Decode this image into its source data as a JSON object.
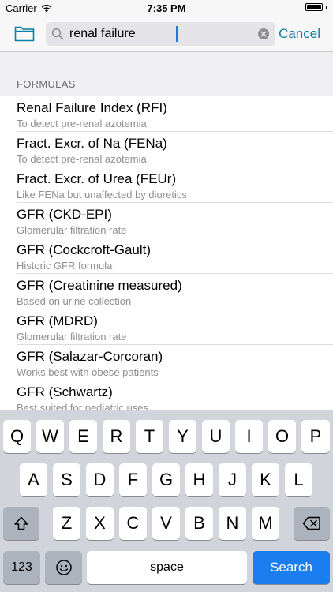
{
  "status_bar": {
    "carrier": "Carrier",
    "time": "7:35 PM",
    "battery_level": 1.0
  },
  "search": {
    "value": "renal failure",
    "placeholder": "",
    "cancel_label": "Cancel"
  },
  "icons": {
    "folder": "folder-icon",
    "search": "search-icon",
    "clear": "clear-icon",
    "wifi": "wifi-icon",
    "shift": "shift-icon",
    "backspace": "backspace-icon",
    "emoji": "emoji-icon"
  },
  "colors": {
    "accent": "#0d7fa6",
    "search_key": "#1a7ef0"
  },
  "section": {
    "title": "FORMULAS",
    "items": [
      {
        "title": "Renal Failure Index (RFI)",
        "subtitle": "To detect pre-renal azotemia"
      },
      {
        "title": "Fract. Excr. of Na (FENa)",
        "subtitle": "To detect pre-renal azotemia"
      },
      {
        "title": "Fract. Excr. of Urea (FEUr)",
        "subtitle": "Like FENa but unaffected by diuretics"
      },
      {
        "title": "GFR (CKD-EPI)",
        "subtitle": "Glomerular filtration rate"
      },
      {
        "title": "GFR (Cockcroft-Gault)",
        "subtitle": "Historic GFR formula"
      },
      {
        "title": "GFR (Creatinine measured)",
        "subtitle": "Based on urine collection"
      },
      {
        "title": "GFR (MDRD)",
        "subtitle": "Glomerular filtration rate"
      },
      {
        "title": "GFR (Salazar-Corcoran)",
        "subtitle": "Works best with obese patients"
      },
      {
        "title": "GFR (Schwartz)",
        "subtitle": "Best suited for pediatric uses"
      }
    ]
  },
  "keyboard": {
    "row1": [
      "Q",
      "W",
      "E",
      "R",
      "T",
      "Y",
      "U",
      "I",
      "O",
      "P"
    ],
    "row2": [
      "A",
      "S",
      "D",
      "F",
      "G",
      "H",
      "J",
      "K",
      "L"
    ],
    "row3": [
      "Z",
      "X",
      "C",
      "V",
      "B",
      "N",
      "M"
    ],
    "numbers_label": "123",
    "space_label": "space",
    "search_label": "Search"
  }
}
